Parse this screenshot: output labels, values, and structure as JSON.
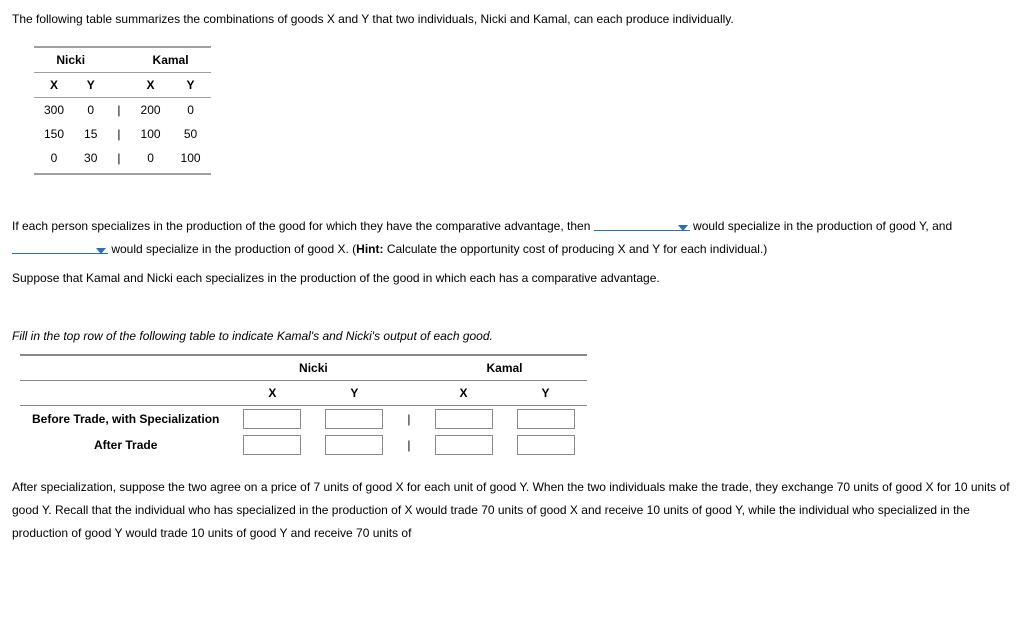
{
  "intro": "The following table summarizes the combinations of goods X and Y that two individuals, Nicki and Kamal, can each produce individually.",
  "ppf": {
    "head_nicki": "Nicki",
    "head_kamal": "Kamal",
    "col_x": "X",
    "col_y": "Y",
    "rows": [
      {
        "nx": "300",
        "ny": "0",
        "kx": "200",
        "ky": "0"
      },
      {
        "nx": "150",
        "ny": "15",
        "kx": "100",
        "ky": "50"
      },
      {
        "nx": "0",
        "ny": "30",
        "kx": "0",
        "ky": "100"
      }
    ],
    "sep": "|"
  },
  "p1": {
    "a": "If each person specializes in the production of the good for which they have the comparative advantage, then ",
    "b": " would specialize in the production of good Y, and ",
    "c": " would specialize in the production of good X. (",
    "hint_label": "Hint:",
    "d": " Calculate the opportunity cost of producing X and Y for each individual.)"
  },
  "p2": "Suppose that Kamal and Nicki each specializes in the production of the good in which each has a comparative advantage.",
  "p3": "Fill in the top row of the following table to indicate Kamal's and Nicki's output of each good.",
  "output_tbl": {
    "head_nicki": "Nicki",
    "head_kamal": "Kamal",
    "col_x": "X",
    "col_y": "Y",
    "sep": "|",
    "row1_label": "Before Trade, with Specialization",
    "row2_label": "After Trade"
  },
  "p4": "After specialization, suppose the two agree on a price of 7 units of good X for each unit of good Y. When the two individuals make the trade, they exchange 70 units of good X for 10 units of good Y. Recall that the individual who has specialized in the production of X would trade 70 units of good X and receive 10 units of good Y, while the individual who specialized in the production of good Y would trade 10 units of good Y and receive 70 units of",
  "chart_data": {
    "type": "table",
    "title": "Production possibilities for Nicki and Kamal",
    "columns": [
      "Nicki_X",
      "Nicki_Y",
      "Kamal_X",
      "Kamal_Y"
    ],
    "rows": [
      [
        300,
        0,
        200,
        0
      ],
      [
        150,
        15,
        100,
        50
      ],
      [
        0,
        30,
        0,
        100
      ]
    ]
  }
}
